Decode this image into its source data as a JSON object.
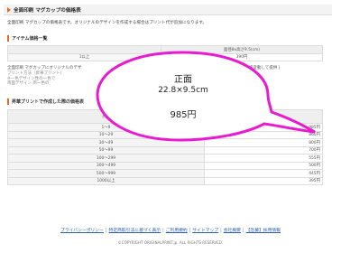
{
  "header": {
    "title": "全面印刷 マグカップの価格表"
  },
  "intro": "全面印刷 マグカップの価格表です。オリジナルのデザインを作成する場合はプリント代が追加になります。",
  "item_section": {
    "title": "アイテム価格一覧",
    "table": {
      "header_right": "面径8x高さ9.5(cm)",
      "rows": [
        {
          "qty": "1以上",
          "price": "390円"
        }
      ]
    }
  },
  "notes": {
    "line1": "全面印刷 マグカップにオリジナルのデザ",
    "line1_tail": "プリントにより価格変動して提供 |",
    "line2": "プリント方法（昇華プリント）",
    "line3": "※一色デザイン性の一色で",
    "line4": "両面デザイン 両一色の",
    "line4_tail": "了承ください。"
  },
  "print_section": {
    "title": "昇華プリントで作成した際の価格表",
    "table": {
      "col_qty": "点数",
      "col_label": "正面",
      "col_size": "22.8x9.5cm",
      "rows": [
        {
          "qty": "1～9",
          "price": "985円"
        },
        {
          "qty": "10～29",
          "price": "860円"
        },
        {
          "qty": "30～49",
          "price": "800円"
        },
        {
          "qty": "50～99",
          "price": "700円"
        },
        {
          "qty": "100～299",
          "price": "555円"
        },
        {
          "qty": "300～499",
          "price": "500円"
        },
        {
          "qty": "500～999",
          "price": "445円"
        },
        {
          "qty": "1000以上",
          "price": "395円"
        }
      ]
    }
  },
  "callout": {
    "label": "正面",
    "size": "22.8×9.5cm",
    "price": "985円",
    "stroke_color": "#e81bd0"
  },
  "footer": {
    "links": [
      "プライバシーポリシー",
      "特定商取引法に基づく表示",
      "ご利用規約",
      "サイトマップ",
      "会社概要",
      "【急募】採用情報"
    ],
    "copyright": "©COPYRIGHT ORIGINALPRINT.jp. ALL RIGHTS RESERVED."
  }
}
